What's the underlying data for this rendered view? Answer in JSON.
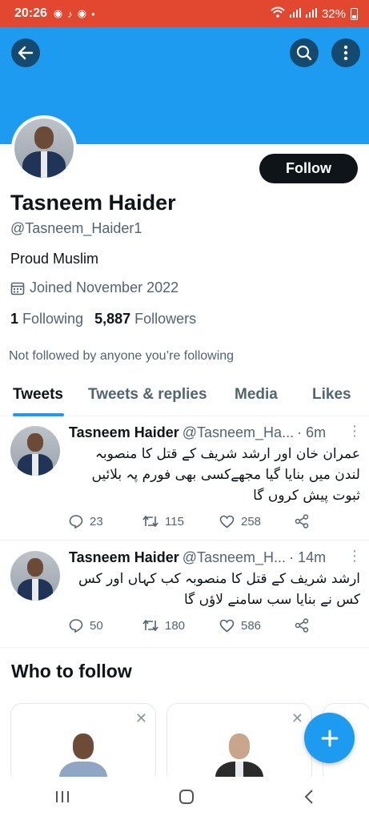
{
  "status_bar": {
    "time": "20:26",
    "battery": "32%",
    "notif_icons": [
      "chrome-icon",
      "tiktok-icon",
      "chrome-icon",
      "dot-icon"
    ]
  },
  "profile": {
    "name": "Tasneem Haider",
    "handle": "@Tasneem_Haider1",
    "bio": "Proud Muslim",
    "joined": "Joined November 2022",
    "following_count": "1",
    "following_label": "Following",
    "followers_count": "5,887",
    "followers_label": "Followers",
    "not_followed": "Not followed by anyone you’re following",
    "follow_label": "Follow"
  },
  "tabs": [
    {
      "label": "Tweets",
      "active": true
    },
    {
      "label": "Tweets & replies",
      "active": false
    },
    {
      "label": "Media",
      "active": false
    },
    {
      "label": "Likes",
      "active": false
    }
  ],
  "tweets": [
    {
      "name": "Tasneem Haider",
      "handle": "@Tasneem_Ha...",
      "time": "· 6m",
      "text": "عمران خان اور ارشد شریف کے قتل کا منصوبہ لندن میں بنایا گیا مجھےکسی بھی فورم پہ بلائیں ثبوت پیش کروں گا",
      "replies": "23",
      "retweets": "115",
      "likes": "258"
    },
    {
      "name": "Tasneem Haider",
      "handle": "@Tasneem_H...",
      "time": "· 14m",
      "text": "ارشد شریف کے قتل کا منصوبہ کب کہاں اور کس کس نے بنایا سب سامنے لاؤں گا",
      "replies": "50",
      "retweets": "180",
      "likes": "586"
    }
  ],
  "who_to_follow": {
    "title": "Who to follow"
  },
  "colors": {
    "accent": "#1d9bf0",
    "status_bar": "#e2472f",
    "text": "#0f1419",
    "secondary": "#536471"
  }
}
